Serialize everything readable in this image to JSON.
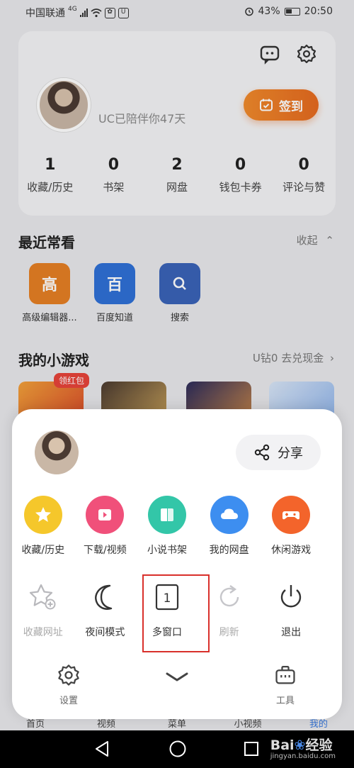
{
  "status_bar": {
    "carrier": "中国联通",
    "network": "4G",
    "app_icon_text": "U",
    "battery": "43%",
    "time": "20:50"
  },
  "profile_card": {
    "uc_days_text": "UC已陪伴你47天",
    "signin_label": "签到",
    "stats": [
      {
        "num": "1",
        "label": "收藏/历史"
      },
      {
        "num": "0",
        "label": "书架"
      },
      {
        "num": "2",
        "label": "网盘"
      },
      {
        "num": "0",
        "label": "钱包卡券"
      },
      {
        "num": "0",
        "label": "评论与赞"
      }
    ]
  },
  "recent": {
    "title": "最近常看",
    "collapse_label": "收起",
    "items": [
      {
        "tile_text": "高",
        "label": "高级编辑器...",
        "color": "#e57f24"
      },
      {
        "tile_text": "百",
        "label": "百度知道",
        "color": "#2f70d6"
      },
      {
        "tile_text": "",
        "label": "搜索",
        "color": "#3a63b8"
      }
    ]
  },
  "games": {
    "title": "我的小游戏",
    "redeem_label": "U钻0 去兑现金",
    "badge": "领红包"
  },
  "menu_sheet": {
    "share_label": "分享",
    "row1": [
      {
        "label": "收藏/历史",
        "color": "#f5c72b",
        "icon": "star-icon"
      },
      {
        "label": "下载/视频",
        "color": "#f0507a",
        "icon": "download-video-icon"
      },
      {
        "label": "小说书架",
        "color": "#33c6a8",
        "icon": "book-icon"
      },
      {
        "label": "我的网盘",
        "color": "#3d8ef0",
        "icon": "cloud-icon"
      },
      {
        "label": "休闲游戏",
        "color": "#f3642b",
        "icon": "gamepad-icon"
      }
    ],
    "row2": [
      {
        "label": "收藏网址",
        "icon": "add-bookmark-icon",
        "enabled": false
      },
      {
        "label": "夜间模式",
        "icon": "moon-icon",
        "enabled": true
      },
      {
        "label": "多窗口",
        "icon": "multi-window-icon",
        "enabled": true,
        "window_count": "1"
      },
      {
        "label": "刷新",
        "icon": "refresh-icon",
        "enabled": false
      },
      {
        "label": "退出",
        "icon": "power-icon",
        "enabled": true
      }
    ],
    "settings_label": "设置",
    "tools_label": "工具"
  },
  "bottom_nav": {
    "items": [
      "首页",
      "视频",
      "菜单",
      "小视频",
      "我的"
    ],
    "active_index": 4
  },
  "watermark": {
    "brand": "Bai",
    "brand_cn": "经验",
    "url": "jingyan.baidu.com"
  },
  "colors": {
    "accent_orange": "#ed7a27",
    "highlight_red": "#d9302b",
    "nav_active": "#3a7be0"
  }
}
